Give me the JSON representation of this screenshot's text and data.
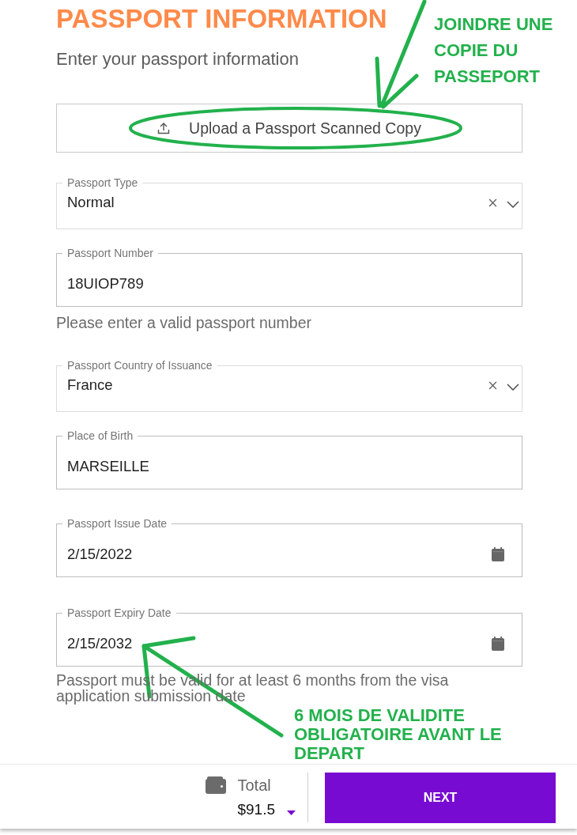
{
  "header": {
    "title": "PASSPORT INFORMATION",
    "subtitle": "Enter your passport information"
  },
  "upload_button": {
    "label": "Upload a Passport Scanned Copy"
  },
  "fields": [
    {
      "kind": "select",
      "label": "Passport Type",
      "value": "Normal"
    },
    {
      "kind": "text",
      "label": "Passport Number",
      "value": "18UIOP789",
      "hint": "Please enter a valid passport number"
    },
    {
      "kind": "select",
      "label": "Passport Country of Issuance",
      "value": "France"
    },
    {
      "kind": "text",
      "label": "Place of Birth",
      "value": "MARSEILLE"
    },
    {
      "kind": "date",
      "label": "Passport Issue Date",
      "value": "2/15/2022"
    },
    {
      "kind": "date",
      "label": "Passport Expiry Date",
      "value": "2/15/2032",
      "hint": "Passport must be valid for at least 6 months from the visa application submission date"
    }
  ],
  "footer": {
    "total_label": "Total",
    "total_amount": "$91.5",
    "button": "NEXT"
  },
  "annotations": [
    {
      "kind": "callout",
      "text": "JOINDRE UNE COPIE DU PASSEPORT"
    },
    {
      "kind": "callout",
      "text": "6 MOIS DE VALIDITE OBLIGATOIRE AVANT LE DEPART"
    }
  ]
}
